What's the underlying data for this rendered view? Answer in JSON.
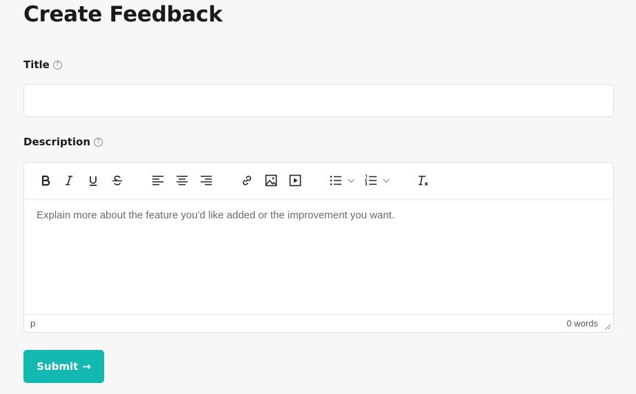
{
  "page": {
    "title": "Create Feedback"
  },
  "form": {
    "title_label": "Title",
    "title_value": "",
    "title_placeholder": "",
    "description_label": "Description",
    "description_placeholder": "Explain more about the feature you'd like added or the improvement you want.",
    "help_glyph": "?"
  },
  "editor": {
    "toolbar_icons": [
      "bold-icon",
      "italic-icon",
      "underline-icon",
      "strikethrough-icon",
      "align-left-icon",
      "align-center-icon",
      "align-right-icon",
      "link-icon",
      "image-icon",
      "media-icon",
      "bullet-list-icon",
      "numbered-list-icon",
      "clear-formatting-icon"
    ],
    "status_path": "p",
    "word_count": "0 words"
  },
  "submit": {
    "label": "Submit",
    "arrow": "→"
  },
  "colors": {
    "accent": "#13b8b0",
    "background": "#f7f7f7"
  }
}
